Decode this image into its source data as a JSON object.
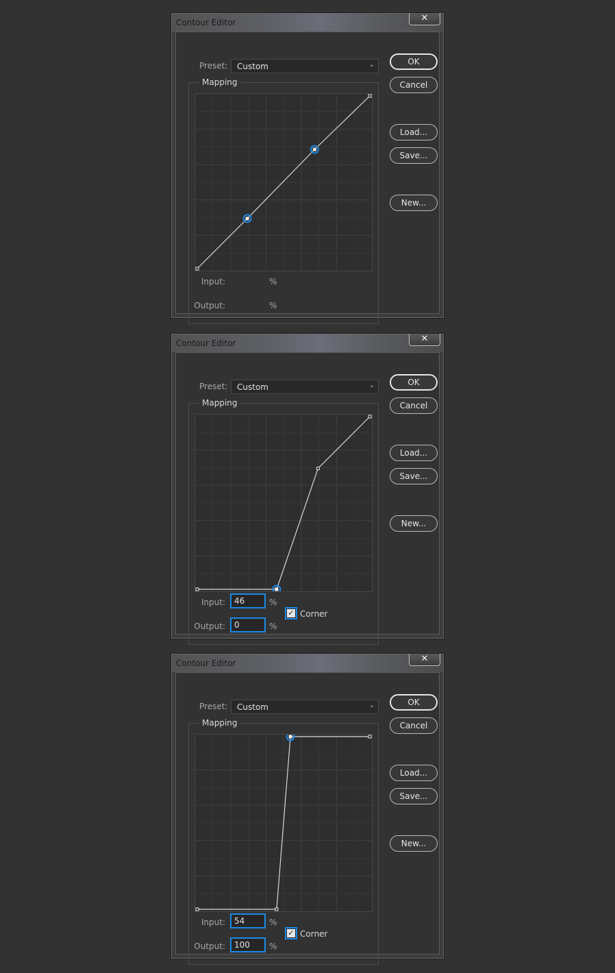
{
  "dialogs": [
    {
      "title": "Contour Editor",
      "close_glyph": "✕",
      "preset_label": "Preset:",
      "preset_value": "Custom",
      "group_label": "Mapping",
      "input_label": "Input:",
      "output_label": "Output:",
      "input_value": "",
      "output_value": "",
      "percent": "%",
      "show_fields": false,
      "corner_label": "",
      "corner_checked": false,
      "points": [
        [
          0,
          0
        ],
        [
          29,
          29
        ],
        [
          68,
          69
        ],
        [
          100,
          100
        ]
      ],
      "selected_points": [
        1,
        2
      ],
      "buttons": {
        "ok": "OK",
        "cancel": "Cancel",
        "load": "Load...",
        "save": "Save...",
        "new": "New..."
      }
    },
    {
      "title": "Contour Editor",
      "close_glyph": "✕",
      "preset_label": "Preset:",
      "preset_value": "Custom",
      "group_label": "Mapping",
      "input_label": "Input:",
      "output_label": "Output:",
      "input_value": "46",
      "output_value": "0",
      "percent": "%",
      "show_fields": true,
      "corner_label": "Corner",
      "corner_checked": true,
      "points": [
        [
          0,
          0
        ],
        [
          46,
          0
        ],
        [
          70,
          70
        ],
        [
          100,
          100
        ]
      ],
      "selected_points": [
        1
      ],
      "buttons": {
        "ok": "OK",
        "cancel": "Cancel",
        "load": "Load...",
        "save": "Save...",
        "new": "New..."
      }
    },
    {
      "title": "Contour Editor",
      "close_glyph": "✕",
      "preset_label": "Preset:",
      "preset_value": "Custom",
      "group_label": "Mapping",
      "input_label": "Input:",
      "output_label": "Output:",
      "input_value": "54",
      "output_value": "100",
      "percent": "%",
      "show_fields": true,
      "corner_label": "Corner",
      "corner_checked": true,
      "points": [
        [
          0,
          0
        ],
        [
          46,
          0
        ],
        [
          54,
          100
        ],
        [
          100,
          100
        ]
      ],
      "selected_points": [
        2
      ],
      "buttons": {
        "ok": "OK",
        "cancel": "Cancel",
        "load": "Load...",
        "save": "Save...",
        "new": "New..."
      }
    }
  ],
  "colors": {
    "accent": "#1e88e5",
    "background": "#323232",
    "curve": "#d9d9d9"
  }
}
